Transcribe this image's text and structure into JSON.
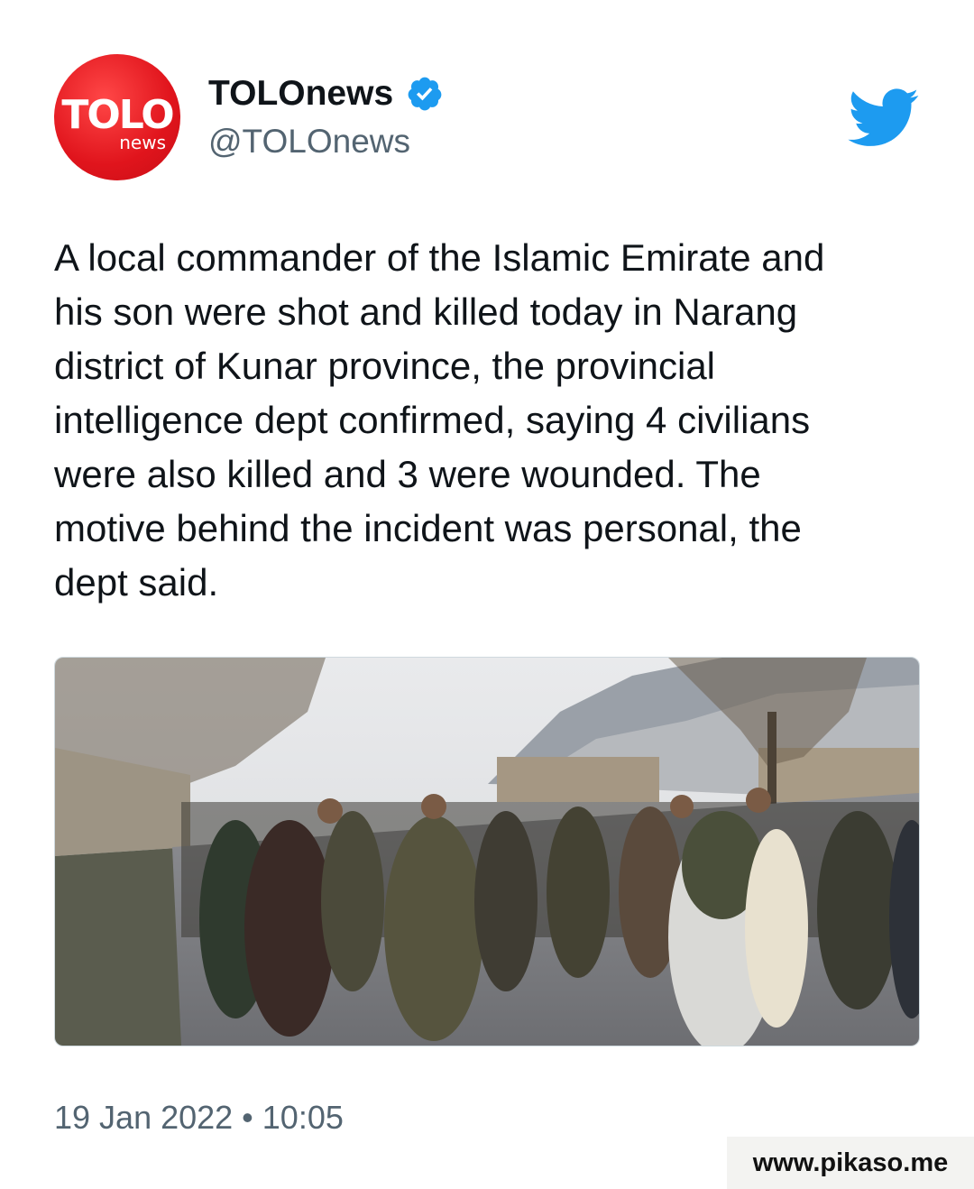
{
  "account": {
    "logo_main": "TOLO",
    "logo_sub": "news",
    "display_name": "TOLOnews",
    "handle": "@TOLOnews",
    "verified": true,
    "avatar_color": "#e0141c"
  },
  "platform_icon": "twitter-bird-icon",
  "accent_color": "#1d9bf0",
  "tweet": {
    "lines": [
      "A local commander of the Islamic Emirate and",
      "his son were shot and killed today in Narang",
      "district of Kunar province, the provincial",
      "intelligence dept confirmed, saying 4 civilians",
      "were also killed and 3 were wounded. The",
      "motive behind the incident was personal, the",
      "dept said."
    ],
    "timestamp": "19 Jan 2022 • 10:05"
  },
  "watermark": "www.pikaso.me"
}
